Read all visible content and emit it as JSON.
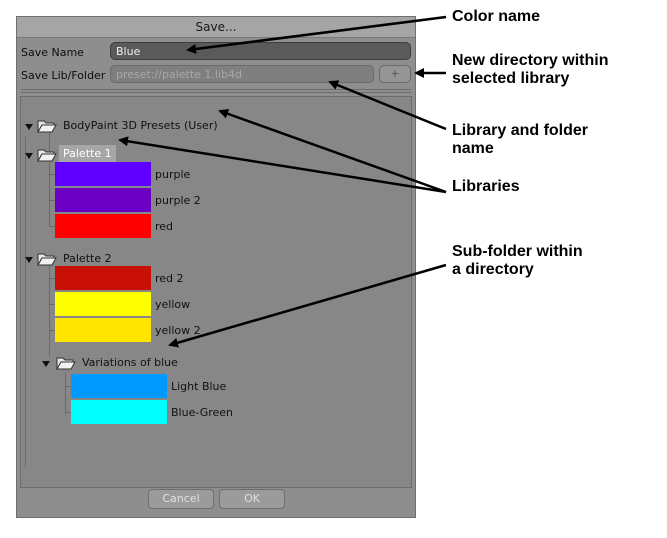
{
  "dialog": {
    "title": "Save...",
    "save_name_label": "Save Name",
    "save_name_value": "Blue",
    "save_lib_label": "Save Lib/Folder",
    "save_lib_placeholder": "preset://palette 1.lib4d",
    "new_folder_glyph": "+",
    "cancel_label": "Cancel",
    "ok_label": "OK"
  },
  "tree": {
    "root": "BodyPaint 3D Presets (User)",
    "palette1": {
      "name": "Palette 1",
      "colors": [
        {
          "name": "purple",
          "color": "#5f00ff"
        },
        {
          "name": "purple 2",
          "color": "#6b00c4"
        },
        {
          "name": "red",
          "color": "#ff0000"
        }
      ]
    },
    "palette2": {
      "name": "Palette 2",
      "colors": [
        {
          "name": "red 2",
          "color": "#c80f05"
        },
        {
          "name": "yellow",
          "color": "#ffff00"
        },
        {
          "name": "yellow 2",
          "color": "#ffe600"
        }
      ]
    },
    "subfolder": {
      "name": "Variations of blue",
      "colors": [
        {
          "name": "Light Blue",
          "color": "#0099ff"
        },
        {
          "name": "Blue-Green",
          "color": "#00ffff"
        }
      ]
    }
  },
  "annotations": {
    "color_name": "Color name",
    "new_dir_line1": "New directory within",
    "new_dir_line2": "selected library",
    "lib_folder_line1": "Library and folder",
    "lib_folder_line2": "name",
    "libraries": "Libraries",
    "subfolder_line1": "Sub-folder within",
    "subfolder_line2": "a directory"
  }
}
